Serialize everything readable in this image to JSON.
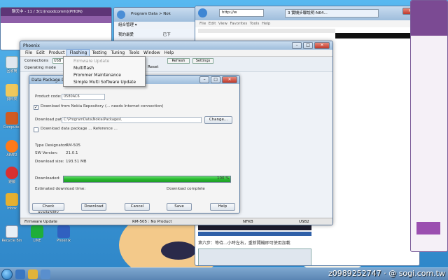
{
  "colors": {
    "accent_purple": "#7b4a93",
    "progress_green": "#27b82f"
  },
  "top_left_window": {
    "title": "聊天中 - 11 / 3(1)(noodcomm)(PHON)"
  },
  "explorer_window": {
    "address": "Program Data > Nok",
    "fav_label": "我的最愛",
    "org_label": "組合管理 ▾",
    "left_item": "已下"
  },
  "browser_window": {
    "address": "http://w",
    "tab_title": "3 實機步驟說明-N64…",
    "menu": [
      "File",
      "Edit",
      "View",
      "Favorites",
      "Tools",
      "Help"
    ],
    "bottom_status": "第六步：等待...小時左右，重新開機即可使用加載"
  },
  "phoenix": {
    "title": "Phoenix",
    "menu": [
      "File",
      "Edit",
      "Product",
      "Flashing",
      "Testing",
      "Tuning",
      "Tools",
      "Window",
      "Help"
    ],
    "active_menu": "Flashing",
    "toolbar_connection_label": "Connections",
    "toolbar_connection_value": "USB",
    "toolbar_operating_label": "Operating mode",
    "toolbar_refresh": "Refresh",
    "toolbar_settings": "Settings",
    "toolbar_reset": "Reset",
    "status_left": "Firmware Update",
    "status_mid": "RM-505 : No Product",
    "status_right": "USB2",
    "status_mid2": "NFKB"
  },
  "flashing_menu": {
    "items": [
      {
        "label": "Firmware Update",
        "disabled": true
      },
      {
        "label": "Multiflash",
        "disabled": false
      },
      {
        "label": "Prommer Maintenance",
        "disabled": false
      },
      {
        "label": "Simple Multi Software Update",
        "disabled": false
      }
    ]
  },
  "dialog": {
    "title": "Data Package Do...",
    "product_code_label": "Product code:",
    "product_code_value": "0580AC6",
    "check1_label": "Download from Nokia Repository (... needs Internet connection)",
    "download_label": "Download path:",
    "download_value": "C:\\ProgramData\\Nokia\\Packages\\",
    "change_button": "Change...",
    "check2_label": "Download data package ... Reference ...",
    "type_label": "Type Designator:",
    "type_value": "RM-505",
    "sw_label": "SW Version:",
    "sw_value": "21.0.1",
    "size_label": "Download size:",
    "size_value": "193.51 MB",
    "downloaded_label": "Downloaded:",
    "progress_percent": 100,
    "progress_text": "100 %",
    "estimate_label": "Estimated download time:",
    "complete_label": "Download complete",
    "buttons": [
      "Check availability",
      "Download",
      "Cancel",
      "Save",
      "Help"
    ]
  },
  "desktop_icons": [
    {
      "label": "回收筒"
    },
    {
      "label": "資料夾"
    },
    {
      "label": "Computer"
    },
    {
      "label": "AIMP2"
    },
    {
      "label": "遊戲"
    },
    {
      "label": "Inbox"
    },
    {
      "label": "LINE"
    },
    {
      "label": "Phoenix"
    },
    {
      "label": "Recycle Bin"
    }
  ],
  "taskbar": {
    "watermark": "z0989252747 · @ sogi.com.tw"
  }
}
